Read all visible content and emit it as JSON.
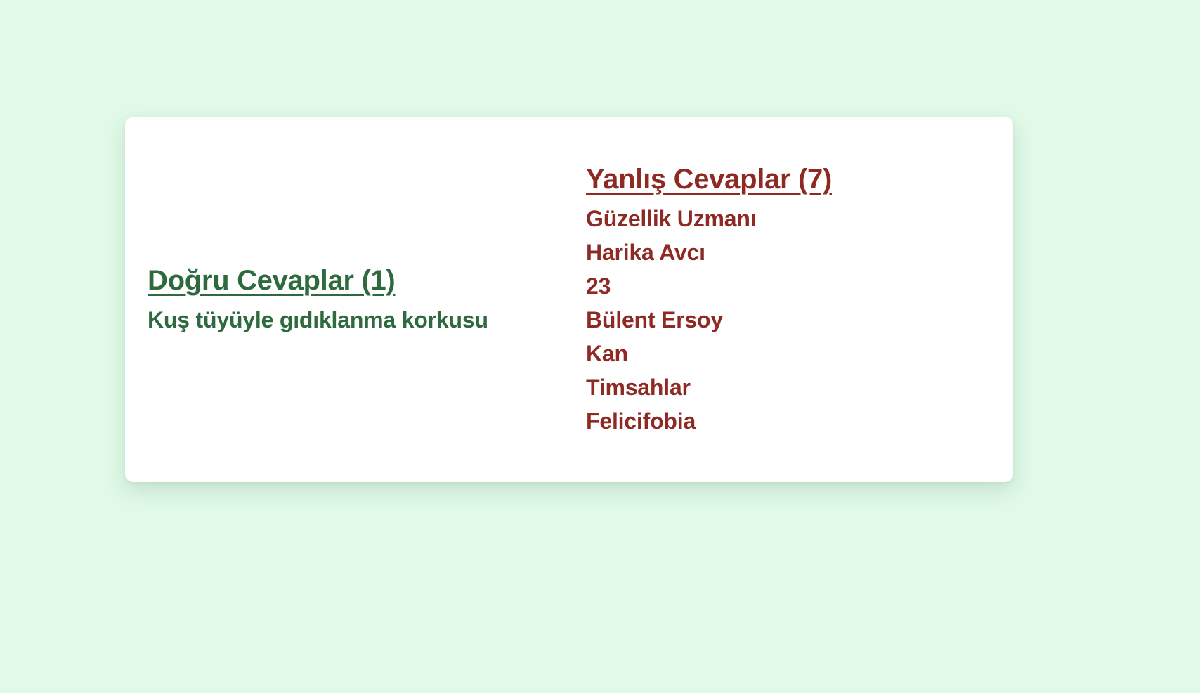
{
  "colors": {
    "background": "#e1f9e8",
    "card": "#ffffff",
    "correct": "#2e6a3e",
    "wrong": "#8e2a23"
  },
  "correct": {
    "heading": "Doğru Cevaplar (1)",
    "items": [
      "Kuş tüyüyle gıdıklanma korkusu"
    ]
  },
  "wrong": {
    "heading": "Yanlış Cevaplar (7)",
    "items": [
      "Güzellik Uzmanı",
      "Harika Avcı",
      "23",
      "Bülent Ersoy",
      "Kan",
      "Timsahlar",
      "Felicifobia"
    ]
  }
}
